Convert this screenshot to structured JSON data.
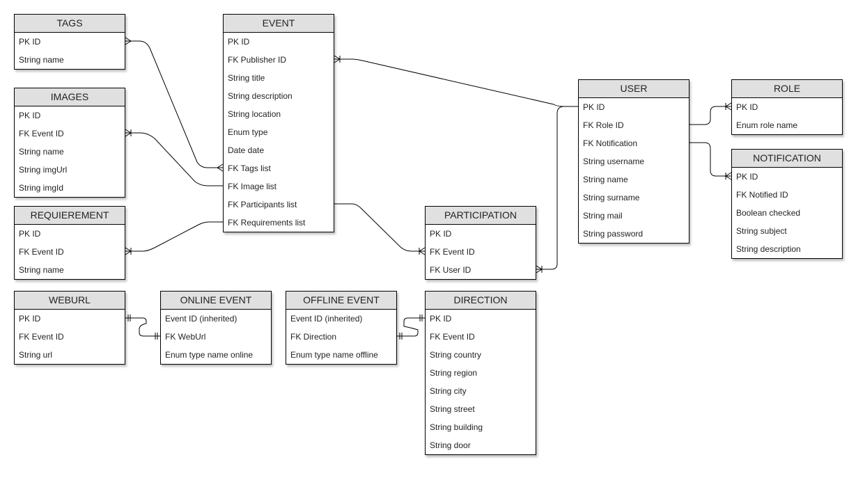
{
  "diagram": {
    "type": "entity-relationship",
    "entities": [
      {
        "id": "tags",
        "title": "TAGS",
        "fields": [
          "PK ID",
          "String name"
        ]
      },
      {
        "id": "images",
        "title": "IMAGES",
        "fields": [
          "PK ID",
          "FK Event ID",
          "String name",
          "String imgUrl",
          "String imgId"
        ]
      },
      {
        "id": "requierement",
        "title": "REQUIEREMENT",
        "fields": [
          "PK ID",
          "FK Event ID",
          "String name"
        ]
      },
      {
        "id": "weburl",
        "title": "WEBURL",
        "fields": [
          "PK ID",
          "FK Event ID",
          "String url"
        ]
      },
      {
        "id": "event",
        "title": "EVENT",
        "fields": [
          "PK ID",
          "FK Publisher ID",
          "String title",
          "String description",
          "String location",
          "Enum type",
          "Date date",
          "FK Tags list",
          "FK Image list",
          "FK Participants list",
          "FK Requirements list"
        ]
      },
      {
        "id": "online_event",
        "title": "ONLINE EVENT",
        "fields": [
          "Event ID (inherited)",
          "FK WebUrl",
          "Enum type name online"
        ]
      },
      {
        "id": "offline_event",
        "title": "OFFLINE EVENT",
        "fields": [
          "Event ID (inherited)",
          "FK Direction",
          "Enum type name offline"
        ]
      },
      {
        "id": "participation",
        "title": "PARTICIPATION",
        "fields": [
          "PK ID",
          "FK Event ID",
          "FK User ID"
        ]
      },
      {
        "id": "direction",
        "title": "DIRECTION",
        "fields": [
          "PK ID",
          "FK Event ID",
          "String country",
          "String region",
          "String city",
          "String street",
          "String building",
          "String door"
        ]
      },
      {
        "id": "user",
        "title": "USER",
        "fields": [
          "PK ID",
          "FK Role ID",
          "FK Notification",
          "String username",
          "String name",
          "String surname",
          "String mail",
          "String password"
        ]
      },
      {
        "id": "role",
        "title": "ROLE",
        "fields": [
          "PK ID",
          "Enum role name"
        ]
      },
      {
        "id": "notification",
        "title": "NOTIFICATION",
        "fields": [
          "PK ID",
          "FK Notified ID",
          "Boolean checked",
          "String subject",
          "String description"
        ]
      }
    ],
    "relationships": [
      {
        "from": "tags.PK ID",
        "to": "event.FK Tags list",
        "from_end": "many",
        "to_end": "many"
      },
      {
        "from": "images.FK Event ID",
        "to": "event.FK Image list",
        "from_end": "one-or-many",
        "to_end": "none"
      },
      {
        "from": "requierement.FK Event ID",
        "to": "event.FK Requirements list",
        "from_end": "one-or-many",
        "to_end": "none"
      },
      {
        "from": "event.FK Publisher ID",
        "to": "user.PK ID",
        "from_end": "one-or-many",
        "to_end": "none"
      },
      {
        "from": "event.FK Participants list",
        "to": "participation.FK Event ID",
        "from_end": "none",
        "to_end": "one-or-many"
      },
      {
        "from": "user.PK ID",
        "to": "participation.FK User ID",
        "from_end": "none",
        "to_end": "one-or-many"
      },
      {
        "from": "user.FK Role ID",
        "to": "role.PK ID",
        "from_end": "none",
        "to_end": "one-or-many"
      },
      {
        "from": "user.FK Notification",
        "to": "notification.PK ID",
        "from_end": "none",
        "to_end": "one-or-many"
      },
      {
        "from": "weburl.PK ID",
        "to": "online_event.FK WebUrl",
        "from_end": "one",
        "to_end": "one"
      },
      {
        "from": "offline_event.FK Direction",
        "to": "direction.PK ID",
        "from_end": "one",
        "to_end": "one"
      }
    ]
  }
}
